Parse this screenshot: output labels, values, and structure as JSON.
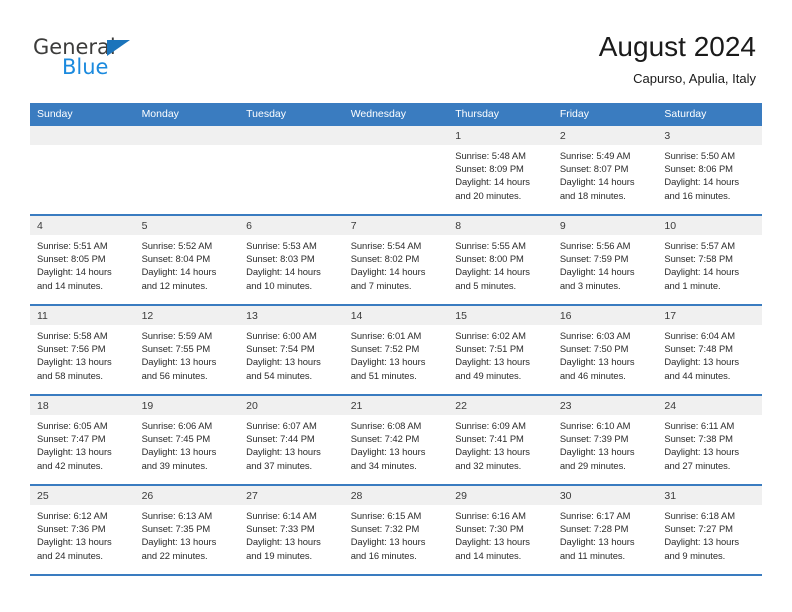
{
  "brand": {
    "name_top": "General",
    "name_bottom": "Blue",
    "triangle_color": "#1b74bb",
    "blue_color": "#1b8ade",
    "gray_color": "#3c3c3b"
  },
  "header": {
    "title": "August 2024",
    "subtitle": "Capurso, Apulia, Italy"
  },
  "theme": {
    "header_blue": "#3a7cc0",
    "date_band": "#f0f0f0",
    "text": "#2b2b2b"
  },
  "weekdays": [
    "Sunday",
    "Monday",
    "Tuesday",
    "Wednesday",
    "Thursday",
    "Friday",
    "Saturday"
  ],
  "weeks": [
    [
      {
        "day": "",
        "sunrise": "",
        "sunset": "",
        "daylight_1": "",
        "daylight_2": ""
      },
      {
        "day": "",
        "sunrise": "",
        "sunset": "",
        "daylight_1": "",
        "daylight_2": ""
      },
      {
        "day": "",
        "sunrise": "",
        "sunset": "",
        "daylight_1": "",
        "daylight_2": ""
      },
      {
        "day": "",
        "sunrise": "",
        "sunset": "",
        "daylight_1": "",
        "daylight_2": ""
      },
      {
        "day": "1",
        "sunrise": "Sunrise: 5:48 AM",
        "sunset": "Sunset: 8:09 PM",
        "daylight_1": "Daylight: 14 hours",
        "daylight_2": "and 20 minutes."
      },
      {
        "day": "2",
        "sunrise": "Sunrise: 5:49 AM",
        "sunset": "Sunset: 8:07 PM",
        "daylight_1": "Daylight: 14 hours",
        "daylight_2": "and 18 minutes."
      },
      {
        "day": "3",
        "sunrise": "Sunrise: 5:50 AM",
        "sunset": "Sunset: 8:06 PM",
        "daylight_1": "Daylight: 14 hours",
        "daylight_2": "and 16 minutes."
      }
    ],
    [
      {
        "day": "4",
        "sunrise": "Sunrise: 5:51 AM",
        "sunset": "Sunset: 8:05 PM",
        "daylight_1": "Daylight: 14 hours",
        "daylight_2": "and 14 minutes."
      },
      {
        "day": "5",
        "sunrise": "Sunrise: 5:52 AM",
        "sunset": "Sunset: 8:04 PM",
        "daylight_1": "Daylight: 14 hours",
        "daylight_2": "and 12 minutes."
      },
      {
        "day": "6",
        "sunrise": "Sunrise: 5:53 AM",
        "sunset": "Sunset: 8:03 PM",
        "daylight_1": "Daylight: 14 hours",
        "daylight_2": "and 10 minutes."
      },
      {
        "day": "7",
        "sunrise": "Sunrise: 5:54 AM",
        "sunset": "Sunset: 8:02 PM",
        "daylight_1": "Daylight: 14 hours",
        "daylight_2": "and 7 minutes."
      },
      {
        "day": "8",
        "sunrise": "Sunrise: 5:55 AM",
        "sunset": "Sunset: 8:00 PM",
        "daylight_1": "Daylight: 14 hours",
        "daylight_2": "and 5 minutes."
      },
      {
        "day": "9",
        "sunrise": "Sunrise: 5:56 AM",
        "sunset": "Sunset: 7:59 PM",
        "daylight_1": "Daylight: 14 hours",
        "daylight_2": "and 3 minutes."
      },
      {
        "day": "10",
        "sunrise": "Sunrise: 5:57 AM",
        "sunset": "Sunset: 7:58 PM",
        "daylight_1": "Daylight: 14 hours",
        "daylight_2": "and 1 minute."
      }
    ],
    [
      {
        "day": "11",
        "sunrise": "Sunrise: 5:58 AM",
        "sunset": "Sunset: 7:56 PM",
        "daylight_1": "Daylight: 13 hours",
        "daylight_2": "and 58 minutes."
      },
      {
        "day": "12",
        "sunrise": "Sunrise: 5:59 AM",
        "sunset": "Sunset: 7:55 PM",
        "daylight_1": "Daylight: 13 hours",
        "daylight_2": "and 56 minutes."
      },
      {
        "day": "13",
        "sunrise": "Sunrise: 6:00 AM",
        "sunset": "Sunset: 7:54 PM",
        "daylight_1": "Daylight: 13 hours",
        "daylight_2": "and 54 minutes."
      },
      {
        "day": "14",
        "sunrise": "Sunrise: 6:01 AM",
        "sunset": "Sunset: 7:52 PM",
        "daylight_1": "Daylight: 13 hours",
        "daylight_2": "and 51 minutes."
      },
      {
        "day": "15",
        "sunrise": "Sunrise: 6:02 AM",
        "sunset": "Sunset: 7:51 PM",
        "daylight_1": "Daylight: 13 hours",
        "daylight_2": "and 49 minutes."
      },
      {
        "day": "16",
        "sunrise": "Sunrise: 6:03 AM",
        "sunset": "Sunset: 7:50 PM",
        "daylight_1": "Daylight: 13 hours",
        "daylight_2": "and 46 minutes."
      },
      {
        "day": "17",
        "sunrise": "Sunrise: 6:04 AM",
        "sunset": "Sunset: 7:48 PM",
        "daylight_1": "Daylight: 13 hours",
        "daylight_2": "and 44 minutes."
      }
    ],
    [
      {
        "day": "18",
        "sunrise": "Sunrise: 6:05 AM",
        "sunset": "Sunset: 7:47 PM",
        "daylight_1": "Daylight: 13 hours",
        "daylight_2": "and 42 minutes."
      },
      {
        "day": "19",
        "sunrise": "Sunrise: 6:06 AM",
        "sunset": "Sunset: 7:45 PM",
        "daylight_1": "Daylight: 13 hours",
        "daylight_2": "and 39 minutes."
      },
      {
        "day": "20",
        "sunrise": "Sunrise: 6:07 AM",
        "sunset": "Sunset: 7:44 PM",
        "daylight_1": "Daylight: 13 hours",
        "daylight_2": "and 37 minutes."
      },
      {
        "day": "21",
        "sunrise": "Sunrise: 6:08 AM",
        "sunset": "Sunset: 7:42 PM",
        "daylight_1": "Daylight: 13 hours",
        "daylight_2": "and 34 minutes."
      },
      {
        "day": "22",
        "sunrise": "Sunrise: 6:09 AM",
        "sunset": "Sunset: 7:41 PM",
        "daylight_1": "Daylight: 13 hours",
        "daylight_2": "and 32 minutes."
      },
      {
        "day": "23",
        "sunrise": "Sunrise: 6:10 AM",
        "sunset": "Sunset: 7:39 PM",
        "daylight_1": "Daylight: 13 hours",
        "daylight_2": "and 29 minutes."
      },
      {
        "day": "24",
        "sunrise": "Sunrise: 6:11 AM",
        "sunset": "Sunset: 7:38 PM",
        "daylight_1": "Daylight: 13 hours",
        "daylight_2": "and 27 minutes."
      }
    ],
    [
      {
        "day": "25",
        "sunrise": "Sunrise: 6:12 AM",
        "sunset": "Sunset: 7:36 PM",
        "daylight_1": "Daylight: 13 hours",
        "daylight_2": "and 24 minutes."
      },
      {
        "day": "26",
        "sunrise": "Sunrise: 6:13 AM",
        "sunset": "Sunset: 7:35 PM",
        "daylight_1": "Daylight: 13 hours",
        "daylight_2": "and 22 minutes."
      },
      {
        "day": "27",
        "sunrise": "Sunrise: 6:14 AM",
        "sunset": "Sunset: 7:33 PM",
        "daylight_1": "Daylight: 13 hours",
        "daylight_2": "and 19 minutes."
      },
      {
        "day": "28",
        "sunrise": "Sunrise: 6:15 AM",
        "sunset": "Sunset: 7:32 PM",
        "daylight_1": "Daylight: 13 hours",
        "daylight_2": "and 16 minutes."
      },
      {
        "day": "29",
        "sunrise": "Sunrise: 6:16 AM",
        "sunset": "Sunset: 7:30 PM",
        "daylight_1": "Daylight: 13 hours",
        "daylight_2": "and 14 minutes."
      },
      {
        "day": "30",
        "sunrise": "Sunrise: 6:17 AM",
        "sunset": "Sunset: 7:28 PM",
        "daylight_1": "Daylight: 13 hours",
        "daylight_2": "and 11 minutes."
      },
      {
        "day": "31",
        "sunrise": "Sunrise: 6:18 AM",
        "sunset": "Sunset: 7:27 PM",
        "daylight_1": "Daylight: 13 hours",
        "daylight_2": "and 9 minutes."
      }
    ]
  ]
}
